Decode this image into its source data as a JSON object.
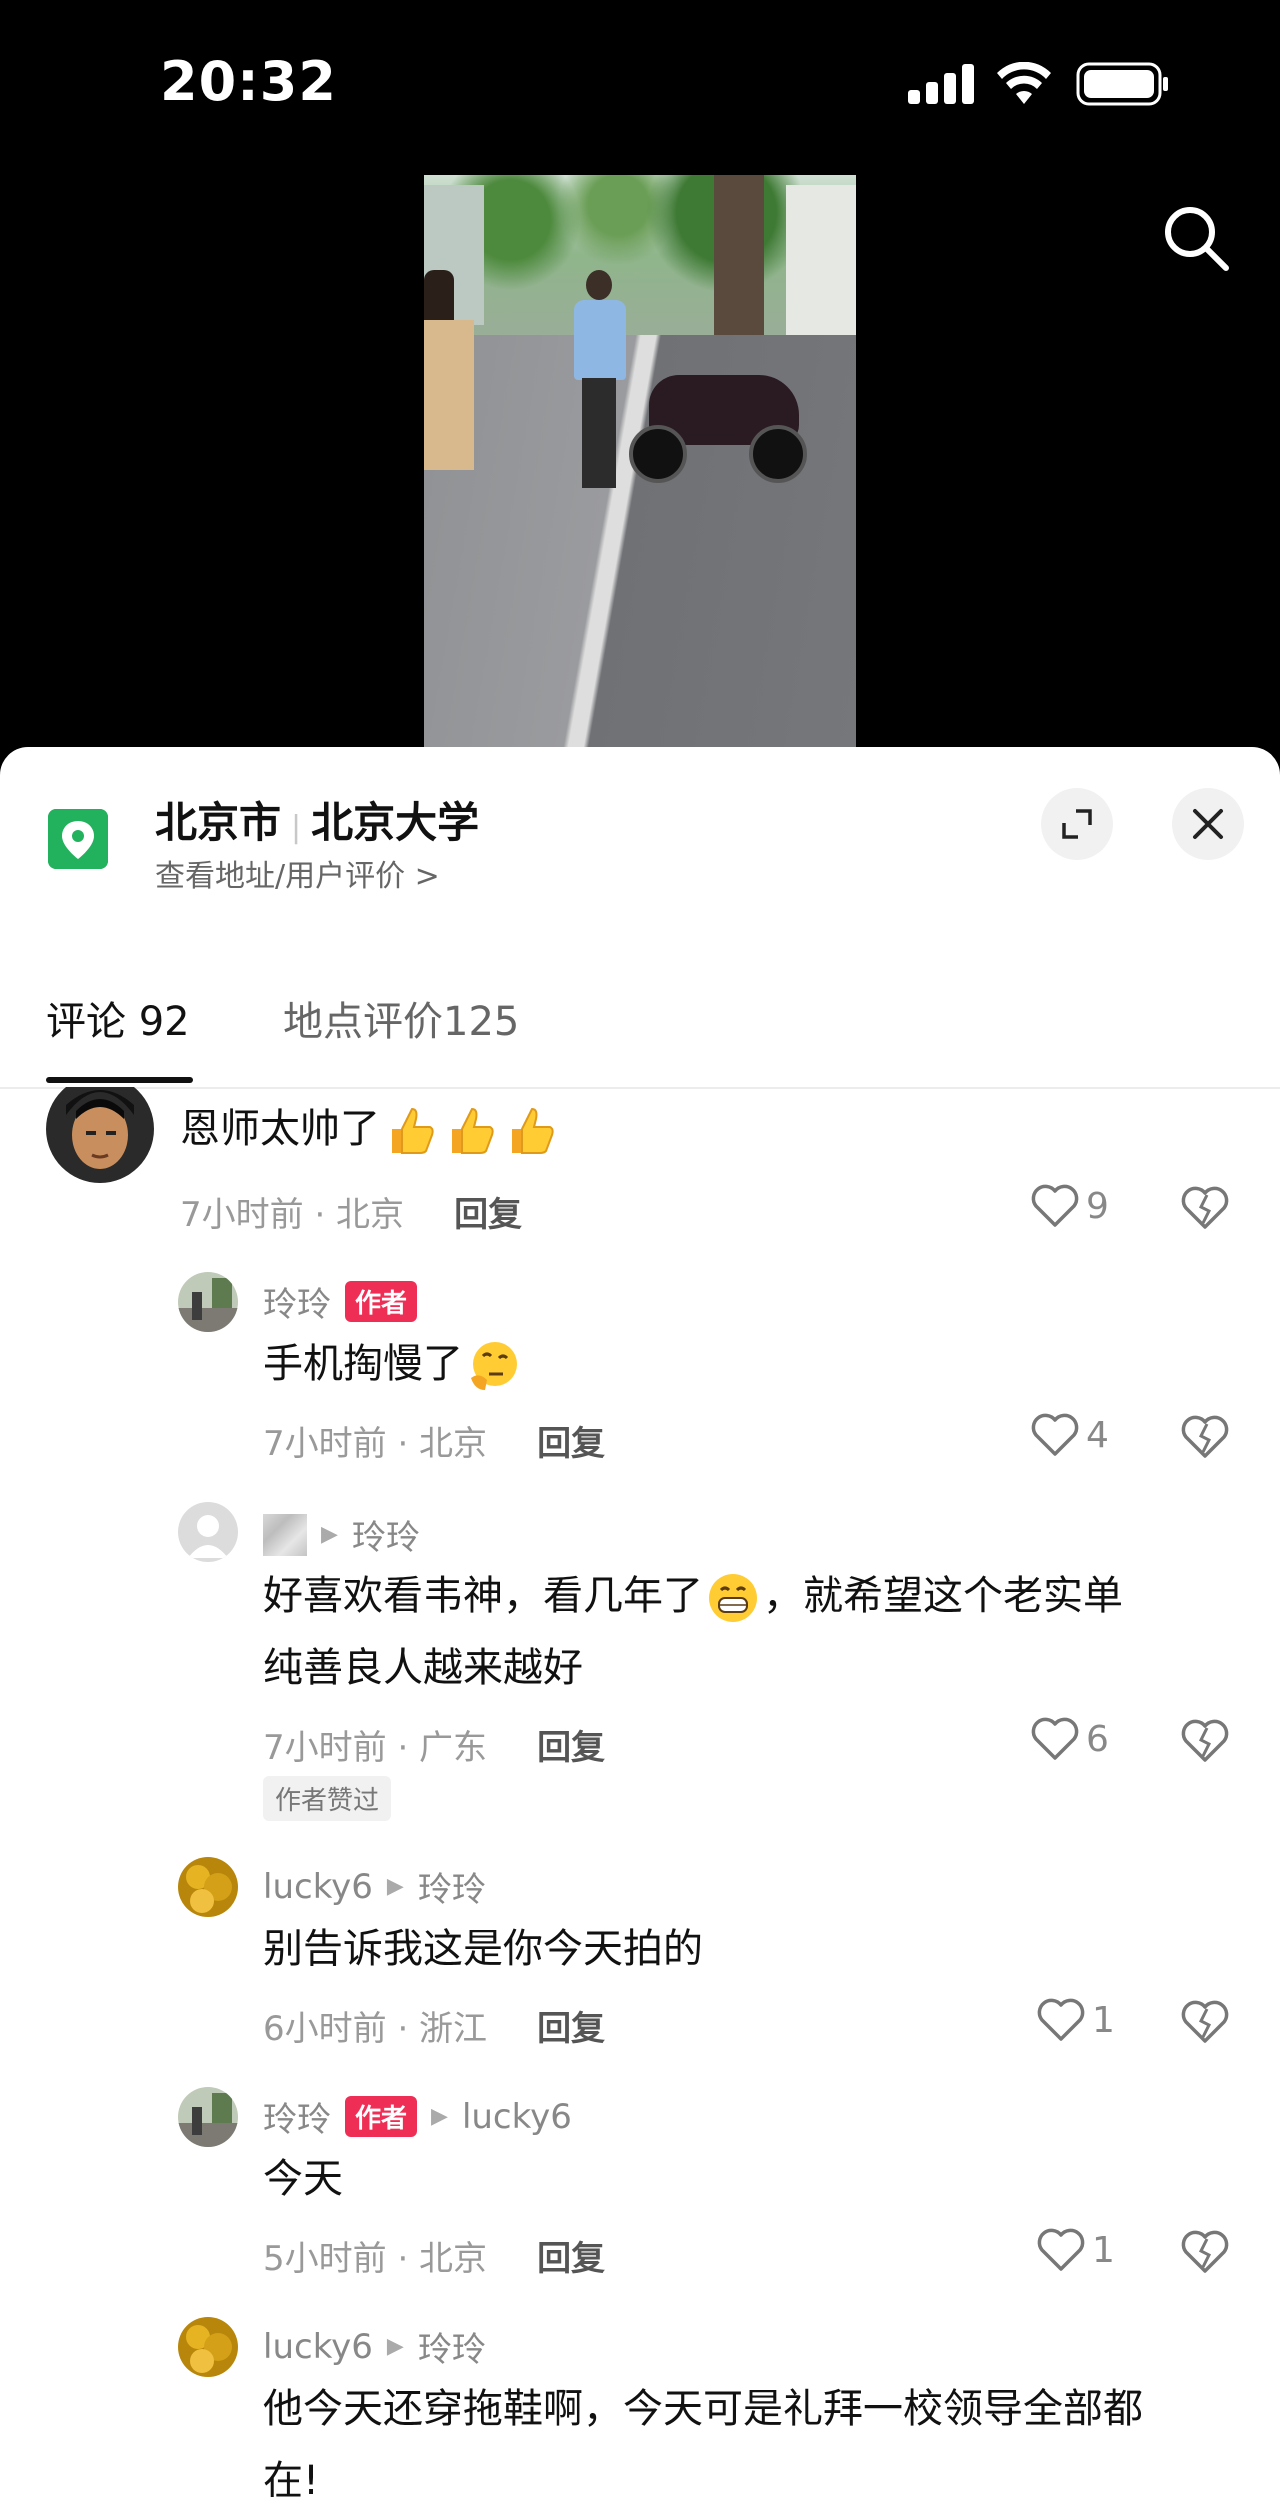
{
  "status_bar": {
    "time": "20:32"
  },
  "video": {
    "description_icon": "video-frame"
  },
  "location": {
    "city": "北京市",
    "place": "北京大学",
    "subtitle": "查看地址/用户评价 >"
  },
  "tabs": [
    {
      "label": "评论 92",
      "active": true
    },
    {
      "label": "地点评价125",
      "active": false
    }
  ],
  "comments": [
    {
      "username": "",
      "text": "恩师太帅了",
      "emojis": [
        "thumbs-up",
        "thumbs-up",
        "thumbs-up"
      ],
      "time_location": "7小时前 · 北京",
      "reply_label": "回复",
      "likes": "9"
    },
    {
      "username": "玲玲",
      "badge": "作者",
      "text": "手机掏慢了",
      "emojis": [
        "thinking-face"
      ],
      "time_location": "7小时前 · 北京",
      "reply_label": "回复",
      "likes": "4"
    },
    {
      "username": "",
      "reply_to": "玲玲",
      "text_line1": "好喜欢看韦神，看几年了",
      "text_line1b": "，就希望这个老实单",
      "text_line2": "纯善良人越来越好",
      "emojis": [
        "grinning-face"
      ],
      "time_location": "7小时前 · 广东",
      "reply_label": "回复",
      "likes": "6",
      "liked_by_author": "作者赞过"
    },
    {
      "username": "lucky6",
      "reply_to": "玲玲",
      "text": "别告诉我这是你今天拍的",
      "time_location": "6小时前 · 浙江",
      "reply_label": "回复",
      "likes": "1"
    },
    {
      "username": "玲玲",
      "badge": "作者",
      "reply_to": "lucky6",
      "text": "今天",
      "time_location": "5小时前 · 北京",
      "reply_label": "回复",
      "likes": "1"
    },
    {
      "username": "lucky6",
      "reply_to": "玲玲",
      "text_line1": "他今天还穿拖鞋啊，今天可是礼拜一校领导全部都",
      "text_line2": "在!"
    }
  ],
  "colors": {
    "accent": "#ef2e55",
    "pin": "#22b25e"
  }
}
